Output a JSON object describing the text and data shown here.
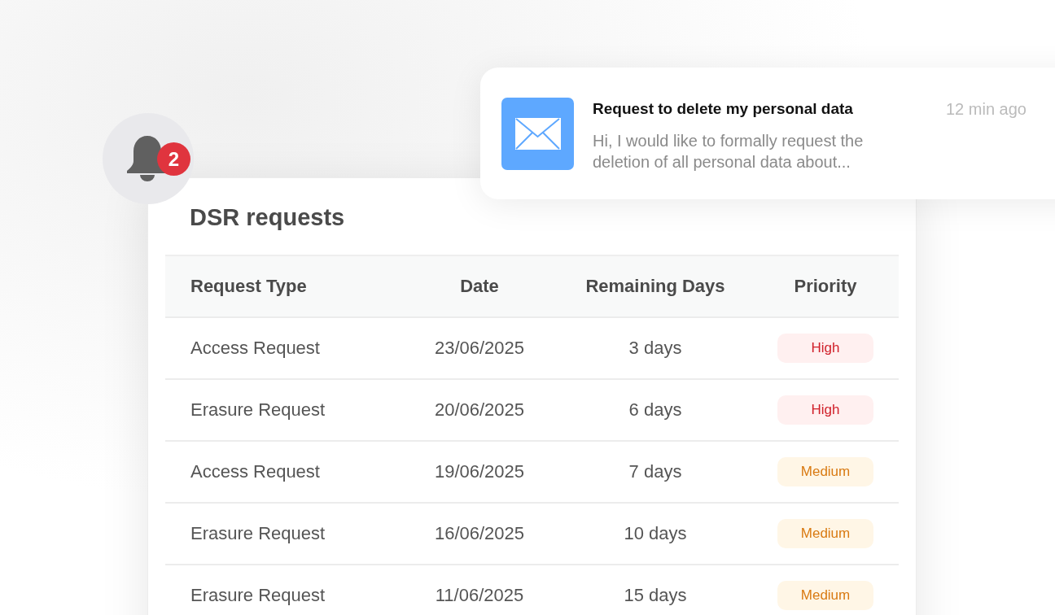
{
  "notification_badge": {
    "count": "2"
  },
  "notification": {
    "title": "Request to delete my personal data",
    "time": "12 min ago",
    "message": "Hi, I would like to formally request the deletion of all personal data about..."
  },
  "card": {
    "title": "DSR requests",
    "table": {
      "columns": [
        "Request Type",
        "Date",
        "Remaining Days",
        "Priority"
      ],
      "rows": [
        {
          "request_type": "Access Request",
          "date": "23/06/2025",
          "remaining_days": "3 days",
          "priority": {
            "label": "High",
            "kind": "high"
          }
        },
        {
          "request_type": "Erasure Request",
          "date": "20/06/2025",
          "remaining_days": "6 days",
          "priority": {
            "label": "High",
            "kind": "high"
          }
        },
        {
          "request_type": "Access Request",
          "date": "19/06/2025",
          "remaining_days": "7 days",
          "priority": {
            "label": "Medium",
            "kind": "medium"
          }
        },
        {
          "request_type": "Erasure Request",
          "date": "16/06/2025",
          "remaining_days": "10 days",
          "priority": {
            "label": "Medium",
            "kind": "medium"
          }
        },
        {
          "request_type": "Erasure Request",
          "date": "11/06/2025",
          "remaining_days": "15 days",
          "priority": {
            "label": "Medium",
            "kind": "medium"
          }
        }
      ]
    }
  }
}
